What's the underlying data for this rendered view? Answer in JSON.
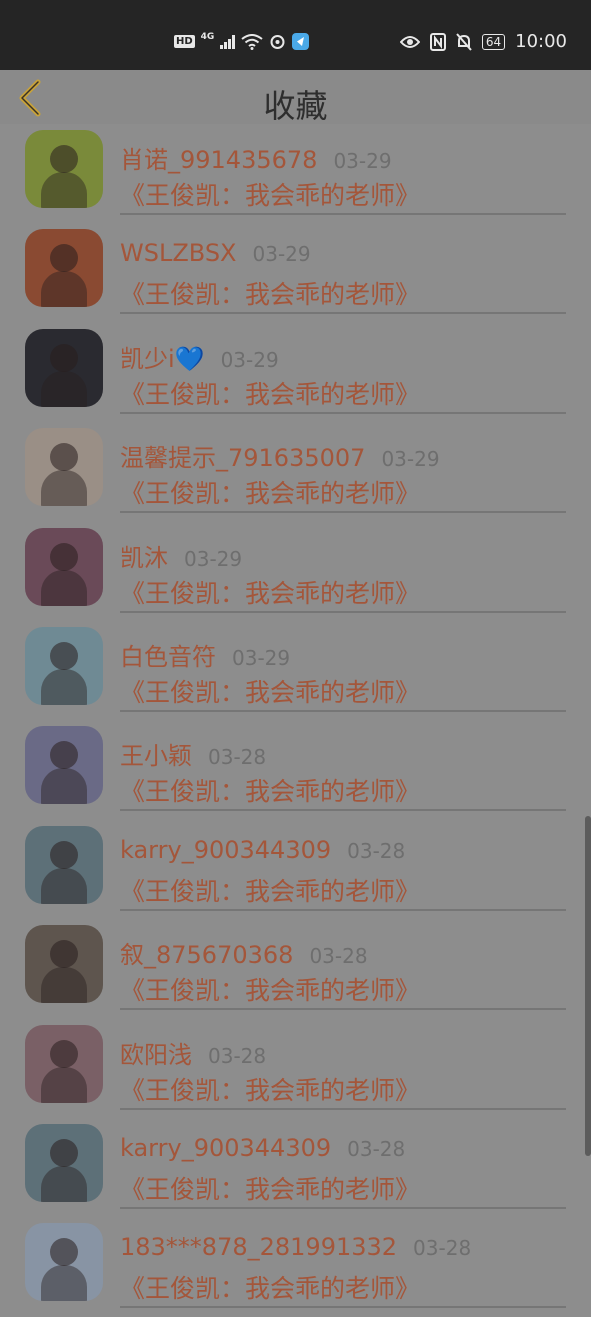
{
  "status_bar": {
    "left_icons": [
      "hd-icon",
      "4g-signal-icon",
      "wifi-icon",
      "sync-icon",
      "app-badge-icon"
    ],
    "right_icons": [
      "eye-icon",
      "nfc-icon",
      "mute-icon",
      "battery-icon"
    ],
    "hd": "HD",
    "network": "4G",
    "battery": "64",
    "time": "10:00"
  },
  "header": {
    "title": "收藏",
    "back_icon": "chevron-left-icon",
    "accent_color": "#c7a23a"
  },
  "favorites": [
    {
      "name": "肖诺_991435678",
      "date": "03-29",
      "book": "《王俊凯：我会乖的老师》",
      "avatar_color": "#7a8a3a"
    },
    {
      "name": "WSLZBSX",
      "date": "03-29",
      "book": "《王俊凯：我会乖的老师》",
      "avatar_color": "#8a4a32"
    },
    {
      "name": "凯少i💙",
      "date": "03-29",
      "book": "《王俊凯：我会乖的老师》",
      "avatar_color": "#2a2a30"
    },
    {
      "name": "温馨提示_791635007",
      "date": "03-29",
      "book": "《王俊凯：我会乖的老师》",
      "avatar_color": "#9a8f86"
    },
    {
      "name": "凯沐",
      "date": "03-29",
      "book": "《王俊凯：我会乖的老师》",
      "avatar_color": "#6a4a58"
    },
    {
      "name": "白色音符",
      "date": "03-29",
      "book": "《王俊凯：我会乖的老师》",
      "avatar_color": "#6f8a94"
    },
    {
      "name": "王小颖",
      "date": "03-28",
      "book": "《王俊凯：我会乖的老师》",
      "avatar_color": "#6a6a86"
    },
    {
      "name": "karry_900344309",
      "date": "03-28",
      "book": "《王俊凯：我会乖的老师》",
      "avatar_color": "#5d7078"
    },
    {
      "name": "叙_875670368",
      "date": "03-28",
      "book": "《王俊凯：我会乖的老师》",
      "avatar_color": "#5e554e"
    },
    {
      "name": "欧阳浅",
      "date": "03-28",
      "book": "《王俊凯：我会乖的老师》",
      "avatar_color": "#7a6066"
    },
    {
      "name": "karry_900344309",
      "date": "03-28",
      "book": "《王俊凯：我会乖的老师》",
      "avatar_color": "#5d7078"
    },
    {
      "name": "183***878_281991332",
      "date": "03-28",
      "book": "《王俊凯：我会乖的老师》",
      "avatar_color": "#8894a4"
    }
  ]
}
